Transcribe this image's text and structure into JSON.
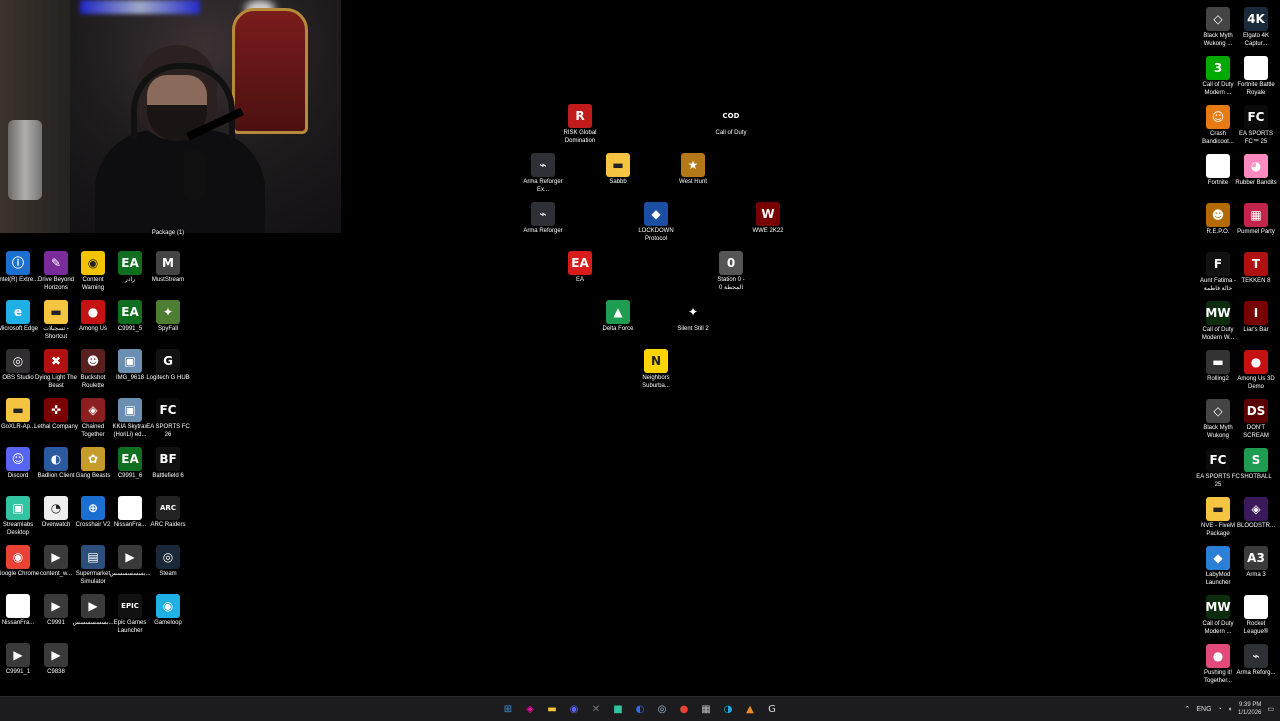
{
  "webcam": {
    "label": "Package (1)"
  },
  "colors": {
    "desktop": "#000000",
    "taskbar": "#1c1c1e",
    "edge_blue": "#1a73e8",
    "steam_dark": "#1b2838",
    "discord": "#5865f2",
    "green_gamepass": "#107c10"
  },
  "left_icons": [
    {
      "label": "Intel(R) Extre...",
      "icon": "intel-icon"
    },
    {
      "label": "Drive Beyond Horizons",
      "icon": "drive-beyond-horizons-icon"
    },
    {
      "label": "Content Warning",
      "icon": "content-warning-icon"
    },
    {
      "label": "رادر",
      "icon": "gamepass-icon"
    },
    {
      "label": "MustStream",
      "icon": "muststream-icon"
    },
    {
      "label": "Microsoft Edge",
      "icon": "edge-icon"
    },
    {
      "label": "تسجيلات - Shortcut",
      "icon": "folder-icon"
    },
    {
      "label": "Among Us",
      "icon": "among-us-icon"
    },
    {
      "label": "C9991_5",
      "icon": "gamepass-icon"
    },
    {
      "label": "SpyFall",
      "icon": "spyfall-icon"
    },
    {
      "label": "OBS Studio",
      "icon": "obs-icon"
    },
    {
      "label": "Dying Light The Beast",
      "icon": "dying-light-icon"
    },
    {
      "label": "Buckshot Roulette",
      "icon": "buckshot-icon"
    },
    {
      "label": "IMG_9618",
      "icon": "image-icon"
    },
    {
      "label": "Logitech G HUB",
      "icon": "logitech-icon"
    },
    {
      "label": "GoXLR-Ap...",
      "icon": "folder-icon"
    },
    {
      "label": "Lethal Company",
      "icon": "lethal-company-icon"
    },
    {
      "label": "Chained Together",
      "icon": "chained-together-icon"
    },
    {
      "label": "KKIA Skytrax (HoriLi) ed...",
      "icon": "image-icon"
    },
    {
      "label": "EA SPORTS FC 26",
      "icon": "ea-fc-icon"
    },
    {
      "label": "Discord",
      "icon": "discord-icon"
    },
    {
      "label": "Badlion Client",
      "icon": "badlion-icon"
    },
    {
      "label": "Gang Beasts",
      "icon": "gang-beasts-icon"
    },
    {
      "label": "C9991_6",
      "icon": "gamepass-icon"
    },
    {
      "label": "Battlefield 6",
      "icon": "battlefield-icon"
    },
    {
      "label": "Streamlabs Desktop",
      "icon": "streamlabs-icon"
    },
    {
      "label": "Overwatch",
      "icon": "overwatch-icon"
    },
    {
      "label": "Crosshair V2",
      "icon": "crosshair-icon"
    },
    {
      "label": "NissanFra...",
      "icon": "blank-file-icon"
    },
    {
      "label": "ARC Raiders",
      "icon": "arc-raiders-icon"
    },
    {
      "label": "Google Chrome",
      "icon": "chrome-icon"
    },
    {
      "label": "content_w...",
      "icon": "video-file-icon"
    },
    {
      "label": "Supermarket Simulator",
      "icon": "supermarket-icon"
    },
    {
      "label": "بسسسسسس...",
      "icon": "video-file-icon"
    },
    {
      "label": "Steam",
      "icon": "steam-icon"
    },
    {
      "label": "NissanFra...",
      "icon": "blank-file-icon"
    },
    {
      "label": "C9991",
      "icon": "video-file-icon"
    },
    {
      "label": "بسسسسسس...",
      "icon": "video-file-icon"
    },
    {
      "label": "Epic Games Launcher",
      "icon": "epic-icon"
    },
    {
      "label": "Gameloop",
      "icon": "gameloop-icon"
    },
    {
      "label": "C9991_1",
      "icon": "video-file-icon"
    },
    {
      "label": "C9838",
      "icon": "video-file-icon"
    }
  ],
  "center_icons": [
    {
      "label": "RISK Global Domination",
      "icon": "risk-icon"
    },
    {
      "label": "Call of Duty",
      "icon": "call-of-duty-icon"
    },
    {
      "label": "Arma Reforger Ex...",
      "icon": "arma-icon"
    },
    {
      "label": "Sabbb",
      "icon": "folder-icon"
    },
    {
      "label": "West Hunt",
      "icon": "west-hunt-icon"
    },
    {
      "label": "Arma Reforger",
      "icon": "arma-icon"
    },
    {
      "label": "LOCKDOWN Protocol",
      "icon": "lockdown-icon"
    },
    {
      "label": "WWE 2K22",
      "icon": "wwe-icon"
    },
    {
      "label": "EA",
      "icon": "ea-icon"
    },
    {
      "label": "Station 0 - المحطة 0",
      "icon": "station-zero-icon"
    },
    {
      "label": "Delta Force",
      "icon": "delta-force-icon"
    },
    {
      "label": "Silent Still 2",
      "icon": "silent-still-icon"
    },
    {
      "label": "Neighbors Suburba...",
      "icon": "neighbors-icon"
    }
  ],
  "right_icons": [
    {
      "label": "Black Myth Wukong ...",
      "icon": "black-myth-icon"
    },
    {
      "label": "Elgato 4K Captur...",
      "icon": "elgato-icon"
    },
    {
      "label": "Call of Duty Modern ...",
      "icon": "mw3-icon"
    },
    {
      "label": "Fortnite Battle Royale",
      "icon": "blank-file-icon"
    },
    {
      "label": "Crash Bandicoot...",
      "icon": "crash-icon"
    },
    {
      "label": "EA SPORTS FC™ 25",
      "icon": "ea-fc-icon"
    },
    {
      "label": "Fortnite",
      "icon": "blank-file-icon"
    },
    {
      "label": "Rubber Bandits",
      "icon": "rubber-bandits-icon"
    },
    {
      "label": "R.E.P.O.",
      "icon": "repo-icon"
    },
    {
      "label": "Pummel Party",
      "icon": "pummel-party-icon"
    },
    {
      "label": "Aunt Fatima - خالة فاطمة",
      "icon": "aunt-fatima-icon"
    },
    {
      "label": "TEKKEN 8",
      "icon": "tekken-icon"
    },
    {
      "label": "Call of Duty Modern W...",
      "icon": "mw-icon"
    },
    {
      "label": "Liar's Bar",
      "icon": "liars-bar-icon"
    },
    {
      "label": "Rolling2",
      "icon": "rolling-icon"
    },
    {
      "label": "Among Us 3D Demo",
      "icon": "among-us-icon"
    },
    {
      "label": "Black Myth Wukong",
      "icon": "black-myth-icon"
    },
    {
      "label": "DON'T SCREAM",
      "icon": "dont-scream-icon"
    },
    {
      "label": "EA SPORTS FC 25",
      "icon": "ea-fc-icon"
    },
    {
      "label": "SHOTBALL",
      "icon": "shotball-icon"
    },
    {
      "label": "NVE - FiveM Package",
      "icon": "folder-icon"
    },
    {
      "label": "BLOODSTR...",
      "icon": "bloodstrike-icon"
    },
    {
      "label": "LabyMod Launcher",
      "icon": "labymod-icon"
    },
    {
      "label": "Arma 3",
      "icon": "arma3-icon"
    },
    {
      "label": "Call of Duty Modern ...",
      "icon": "mw-icon"
    },
    {
      "label": "Rocket League®",
      "icon": "blank-file-icon"
    },
    {
      "label": "Pushing it! Together...",
      "icon": "pushing-it-icon"
    },
    {
      "label": "Arma Reforg...",
      "icon": "arma-icon"
    }
  ],
  "taskbar": {
    "apps": [
      {
        "name": "start-button",
        "glyph": "⊞",
        "color": "#3a96dd"
      },
      {
        "name": "copilot-icon",
        "glyph": "◈",
        "color": "#f0a"
      },
      {
        "name": "file-explorer-icon",
        "glyph": "▬",
        "color": "#f5c542"
      },
      {
        "name": "discord-tb-icon",
        "glyph": "◉",
        "color": "#5865f2"
      },
      {
        "name": "capture-tb-icon",
        "glyph": "✕",
        "color": "#777"
      },
      {
        "name": "streamlabs-tb-icon",
        "glyph": "■",
        "color": "#31c3a2"
      },
      {
        "name": "edge-dev-tb-icon",
        "glyph": "◐",
        "color": "#2f6de0"
      },
      {
        "name": "steam-tb-icon",
        "glyph": "◎",
        "color": "#9fc2e8"
      },
      {
        "name": "chrome-tb-icon",
        "glyph": "●",
        "color": "#e94235"
      },
      {
        "name": "calculator-tb-icon",
        "glyph": "▦",
        "color": "#bbb"
      },
      {
        "name": "edge-tb-icon",
        "glyph": "◑",
        "color": "#1fb0e6"
      },
      {
        "name": "vlc-tb-icon",
        "glyph": "▲",
        "color": "#f08a24"
      },
      {
        "name": "logitech-tb-icon",
        "glyph": "G",
        "color": "#ddd"
      }
    ],
    "tray": {
      "lang": "ENG",
      "time": "9:39 PM",
      "date": "1/1/2026"
    }
  }
}
